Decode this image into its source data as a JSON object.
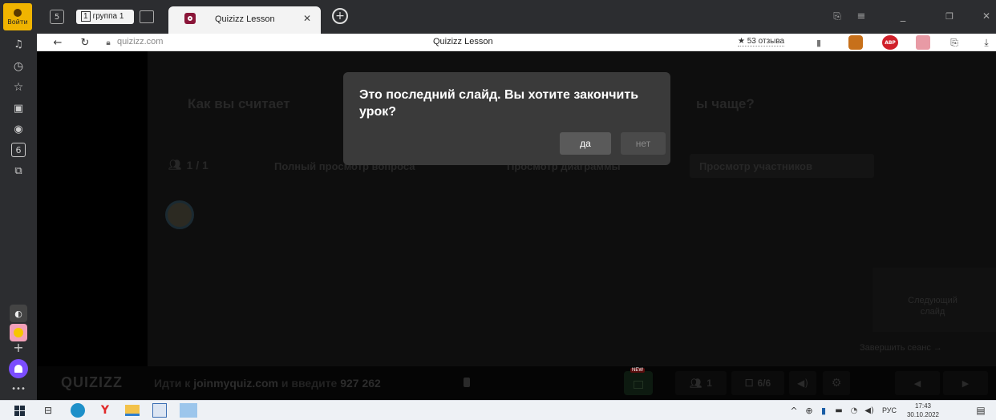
{
  "browser": {
    "login_label": "Войти",
    "group_tab": "группа 1",
    "active_tab_title": "Quizizz Lesson",
    "url": "quizizz.com",
    "page_title": "Quizizz Lesson",
    "reviews": "★ 53 отзыва"
  },
  "lesson": {
    "question": "Как вы считаете, ... чаще?",
    "question_left": "Как вы считает",
    "question_right": "ы чаще?",
    "participants_count": "1 / 1",
    "tabs": [
      "Полный просмотр вопроса",
      "Просмотр диаграммы",
      "Просмотр участников"
    ],
    "next_slide": "Следующий слайд",
    "end_session": "Завершить сеанс →"
  },
  "dialog": {
    "message": "Это последний слайд. Вы хотите закончить урок?",
    "yes": "да",
    "no": "нет"
  },
  "footer": {
    "logo": "QUIZIZZ",
    "join_prefix": "Идти к ",
    "join_site": "joinmyquiz.com",
    "join_mid": " и введите ",
    "code": "927 262",
    "players": "1",
    "slides": "6/6",
    "badge": "NEW"
  },
  "taskbar": {
    "lang": "РУС",
    "time": "17:43",
    "date": "30.10.2022"
  }
}
